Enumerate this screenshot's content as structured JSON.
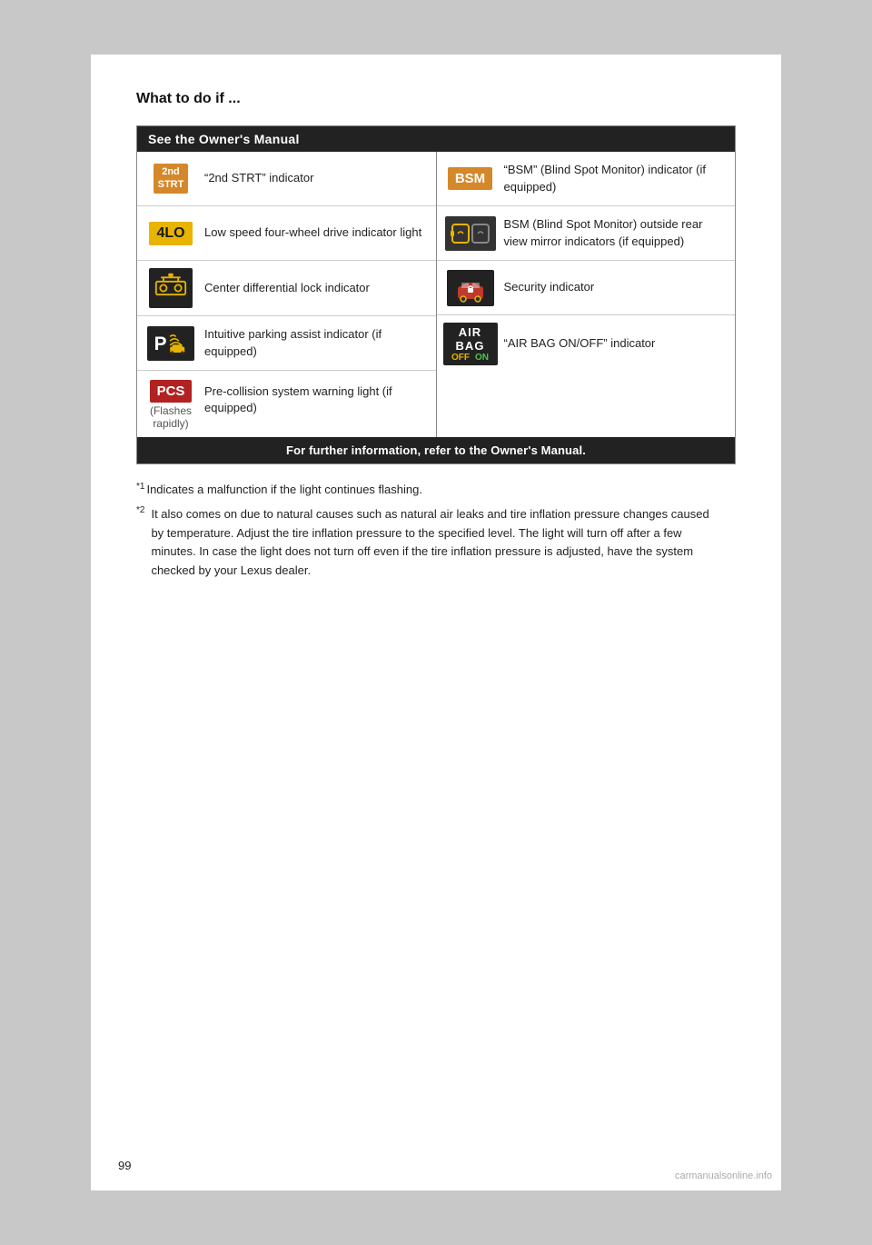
{
  "page": {
    "number": "99",
    "watermark": "carmanualsonline.info"
  },
  "section_title": "What to do if ...",
  "table": {
    "header": "See the Owner's Manual",
    "footer": "For further information, refer to the Owner's Manual.",
    "left_rows": [
      {
        "icon_type": "2nd-strt",
        "icon_label": "",
        "text": "“2nd STRT” indicator"
      },
      {
        "icon_type": "4lo",
        "icon_label": "",
        "text": "Low speed four-wheel drive indicator light"
      },
      {
        "icon_type": "diff-lock",
        "icon_label": "",
        "text": "Center differential lock indicator"
      },
      {
        "icon_type": "parking",
        "icon_label": "",
        "text": "Intuitive parking assist indicator (if equipped)"
      },
      {
        "icon_type": "pcs",
        "icon_label": "(Flashes\nrapidly)",
        "text": "Pre-collision system warning light (if equipped)"
      }
    ],
    "right_rows": [
      {
        "icon_type": "bsm",
        "icon_label": "",
        "text": "“BSM” (Blind Spot Monitor) indicator (if equipped)"
      },
      {
        "icon_type": "bsm-mirror",
        "icon_label": "",
        "text": "BSM (Blind Spot Monitor) outside rear view mirror indicators (if equipped)"
      },
      {
        "icon_type": "security",
        "icon_label": "",
        "text": "Security indicator"
      },
      {
        "icon_type": "airbag",
        "icon_label": "",
        "text": "“AIR BAG ON/OFF” indicator"
      }
    ]
  },
  "footnotes": [
    {
      "sup": "*1",
      "text": "Indicates a malfunction if the light continues flashing."
    },
    {
      "sup": "*2",
      "text": "It also comes on due to natural causes such as natural air leaks and tire inflation pressure changes caused by temperature. Adjust the tire inflation pressure to the specified level. The light will turn off after a few minutes. In case the light does not turn off even if the tire inflation pressure is adjusted, have the system checked by your Lexus dealer."
    }
  ]
}
